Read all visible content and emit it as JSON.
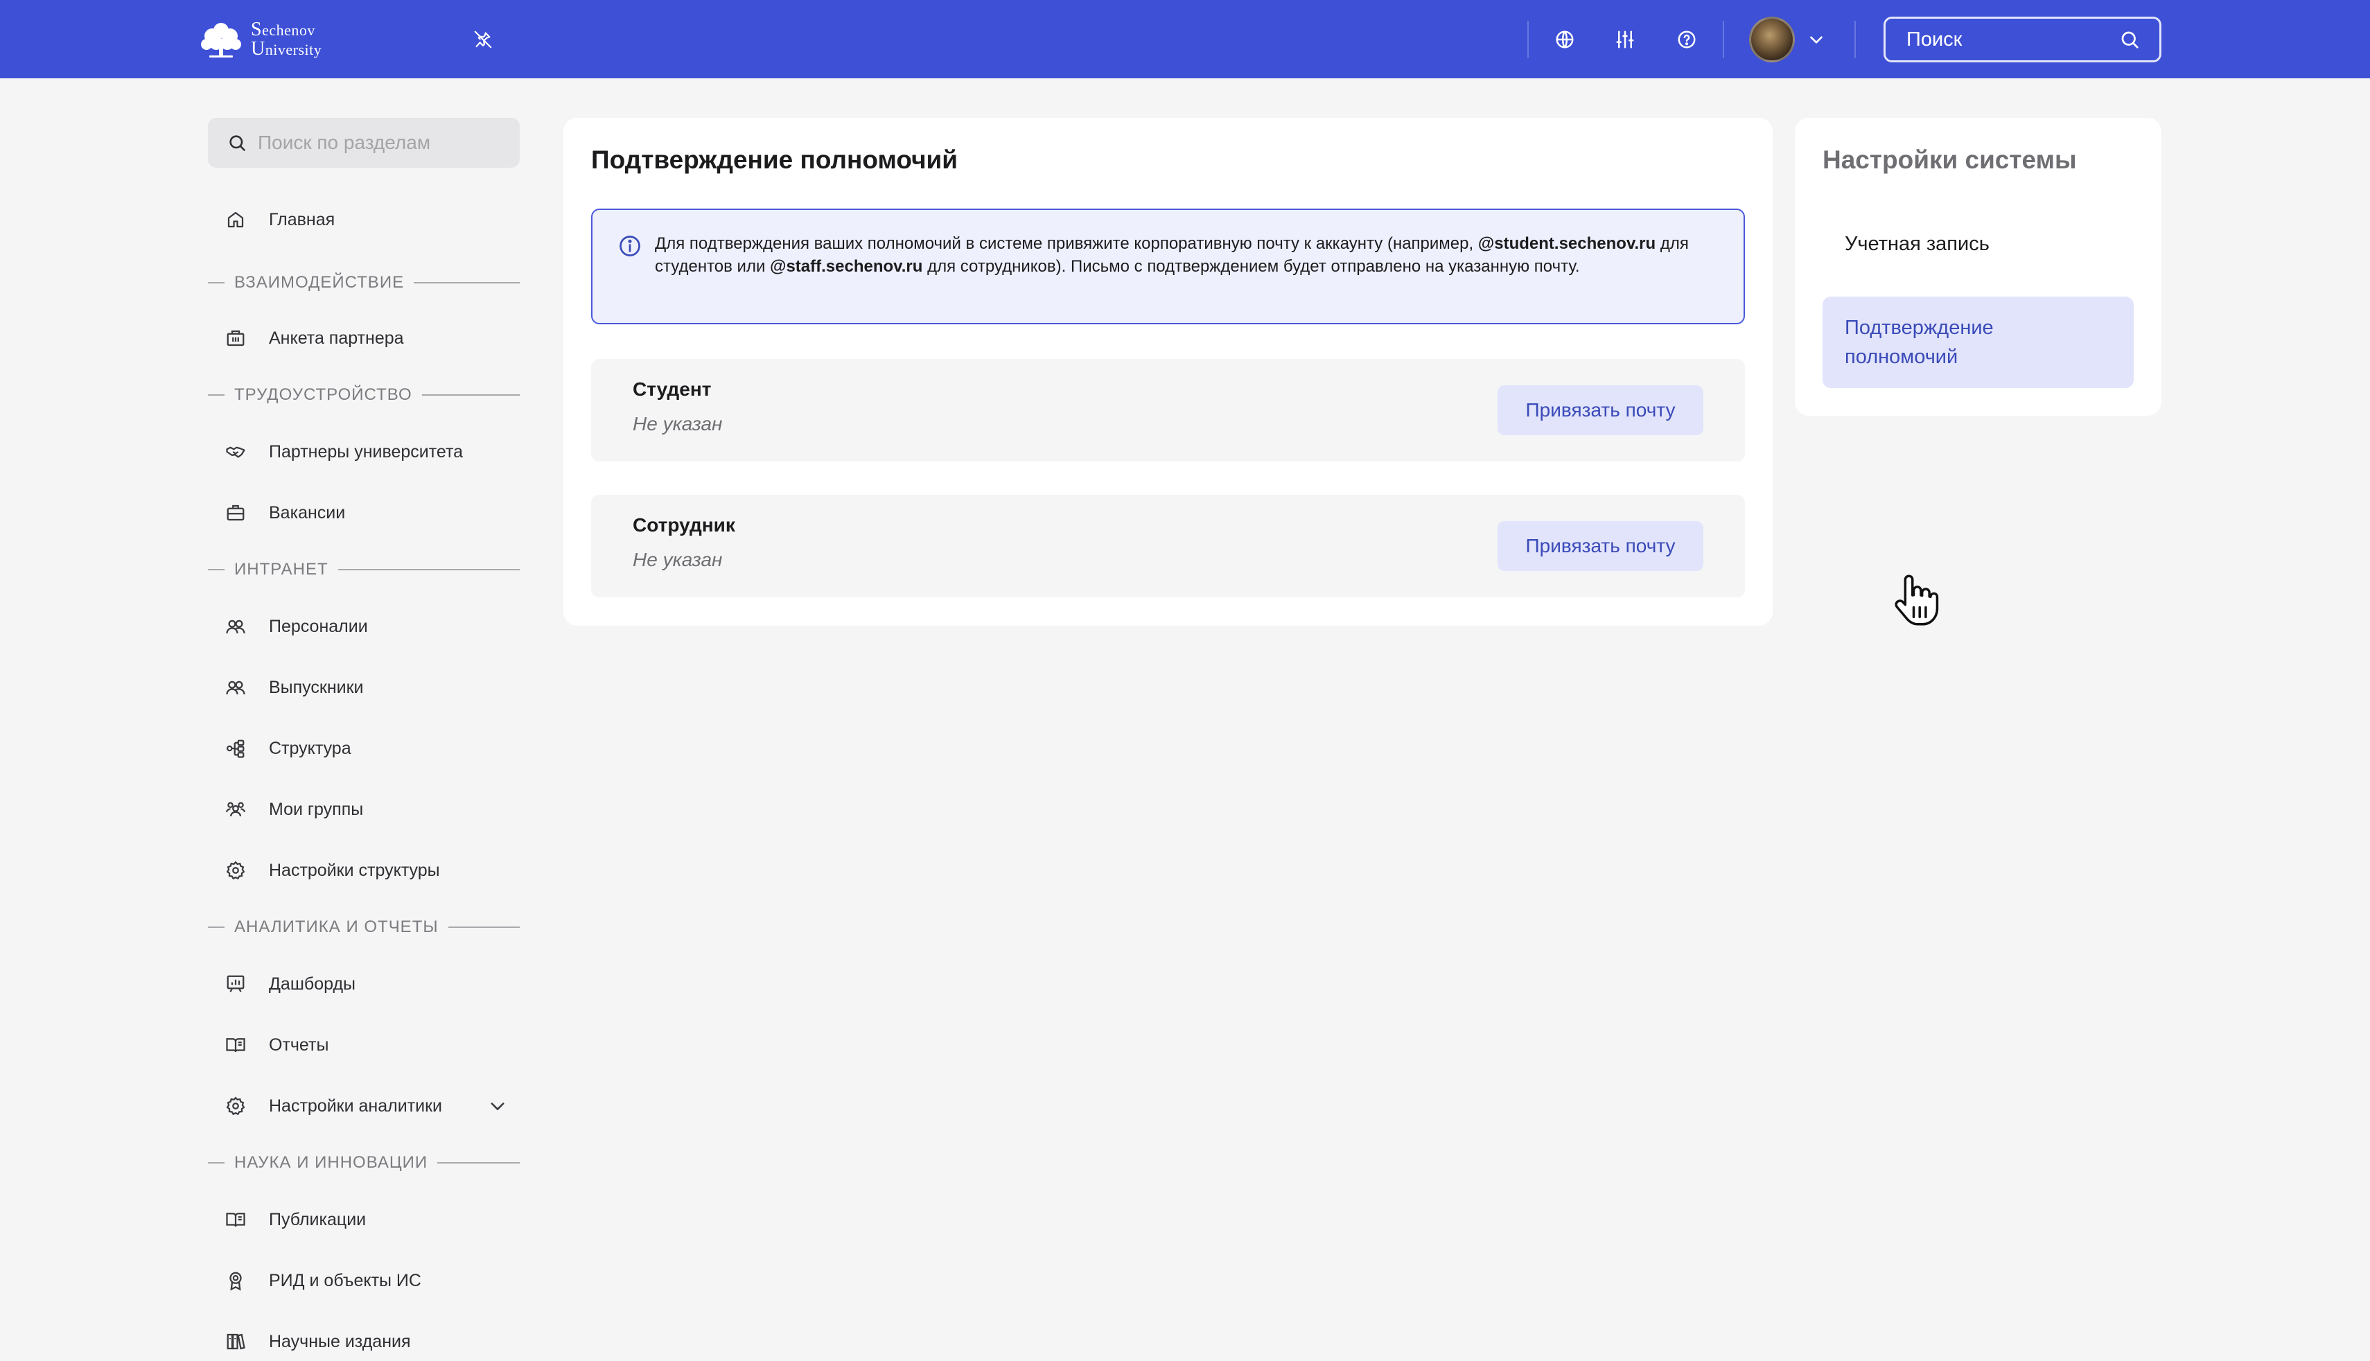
{
  "topbar": {
    "logo_line1": "Sechenov",
    "logo_line2": "University",
    "search_placeholder": "Поиск",
    "icons": [
      "globe-icon",
      "sliders-icon",
      "help-icon",
      "chevron-down-icon",
      "search-icon",
      "pin-off-icon"
    ]
  },
  "sidebar": {
    "search_placeholder": "Поиск по разделам",
    "items": [
      {
        "label": "Главная",
        "icon": "home-icon"
      },
      {
        "label": "Анкета партнера",
        "icon": "building-icon"
      },
      {
        "label": "Партнеры университета",
        "icon": "handshake-icon"
      },
      {
        "label": "Вакансии",
        "icon": "briefcase-icon"
      },
      {
        "label": "Персоналии",
        "icon": "people-icon"
      },
      {
        "label": "Выпускники",
        "icon": "people-icon"
      },
      {
        "label": "Структура",
        "icon": "structure-icon"
      },
      {
        "label": "Мои группы",
        "icon": "group-icon"
      },
      {
        "label": "Настройки структуры",
        "icon": "gear-icon"
      },
      {
        "label": "Дашборды",
        "icon": "dashboard-icon"
      },
      {
        "label": "Отчеты",
        "icon": "book-icon"
      },
      {
        "label": "Настройки аналитики",
        "icon": "gear-icon"
      },
      {
        "label": "Публикации",
        "icon": "book-icon"
      },
      {
        "label": "РИД и объекты ИС",
        "icon": "award-icon"
      },
      {
        "label": "Научные издания",
        "icon": "library-icon"
      }
    ],
    "sections": [
      "ВЗАИМОДЕЙСТВИЕ",
      "ТРУДОУСТРОЙСТВО",
      "ИНТРАНЕТ",
      "АНАЛИТИКА И ОТЧЕТЫ",
      "НАУКА И ИННОВАЦИИ"
    ]
  },
  "main": {
    "title": "Подтверждение полномочий",
    "info": {
      "part1": "Для подтверждения ваших полномочий в системе привяжите корпоративную почту к аккаунту (например, ",
      "domain_student": "@student.sechenov.ru",
      "part2": " для студентов или ",
      "domain_staff": "@staff.sechenov.ru",
      "part3": " для сотрудников). Письмо с подтверждением будет отправлено на указанную почту."
    },
    "roles": [
      {
        "name": "Студент",
        "value": "Не указан",
        "button": "Привязать почту"
      },
      {
        "name": "Сотрудник",
        "value": "Не указан",
        "button": "Привязать почту"
      }
    ]
  },
  "settings_panel": {
    "title": "Настройки системы",
    "items": [
      {
        "label": "Учетная запись",
        "active": false
      },
      {
        "label": "Подтверждение полномочий",
        "active": true
      }
    ]
  },
  "colors": {
    "topbar": "#3d50d6",
    "accent_text": "#3a4ab8",
    "accent_bg": "#e1e4fb",
    "page_bg": "#f5f5f6"
  }
}
